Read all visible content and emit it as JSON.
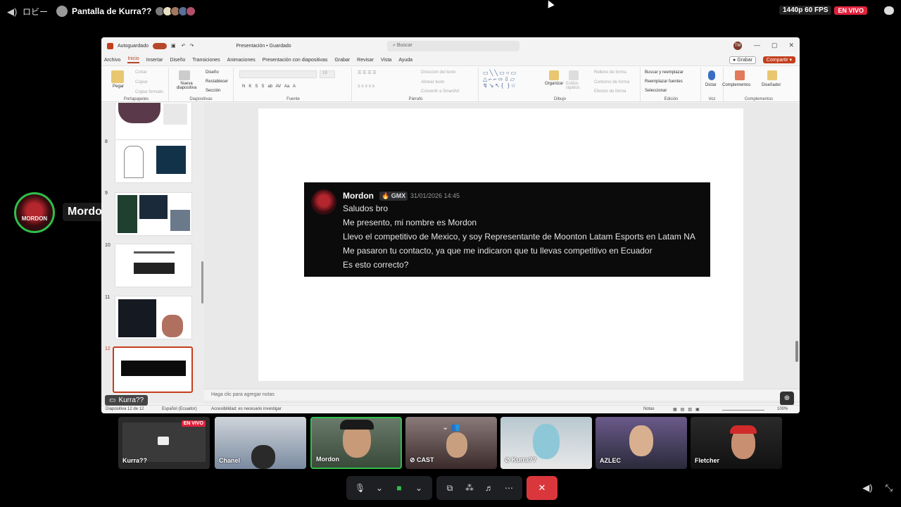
{
  "topbar": {
    "lobby": "ロビー",
    "title": "Pantalla de Kurra??",
    "quality": "1440p 60 FPS",
    "live": "EN VIVO",
    "viewer_colors": [
      "#7a7a7a",
      "#e8e0c0",
      "#a37860",
      "#5a6e9a",
      "#b0506a"
    ]
  },
  "ppt": {
    "autosave": "Autoguardado",
    "doc_title": "Presentación • Guardado",
    "search_placeholder": "Buscar",
    "user_initials": "TM",
    "tabs": [
      "Archivo",
      "Inicio",
      "Insertar",
      "Diseño",
      "Transiciones",
      "Animaciones",
      "Presentación con diapositivas",
      "Grabar",
      "Revisar",
      "Vista",
      "Ayuda"
    ],
    "active_tab": "Inicio",
    "record_label": "Grabar",
    "share_label": "Compartir",
    "groups": {
      "clipboard": {
        "label": "Portapapeles",
        "paste": "Pegar",
        "cut": "Cortar",
        "copy": "Copiar",
        "format": "Copiar formato"
      },
      "slides": {
        "label": "Diapositivas",
        "new": "Nueva diapositiva",
        "layout": "Diseño",
        "reset": "Restablecer",
        "section": "Sección"
      },
      "font": {
        "label": "Fuente",
        "size": "18"
      },
      "paragraph": {
        "label": "Párrafo",
        "direction": "Dirección del texto",
        "align": "Alinear texto",
        "smartart": "Convertir a SmartArt"
      },
      "drawing": {
        "label": "Dibujo",
        "arrange": "Organizar",
        "styles": "Estilos rápidos",
        "fill": "Relleno de forma",
        "outline": "Contorno de forma",
        "effects": "Efectos de forma"
      },
      "editing": {
        "label": "Edición",
        "find": "Buscar y reemplazar",
        "replace": "Reemplazar fuentes",
        "select": "Seleccionar"
      },
      "voice": {
        "label": "Voz",
        "dictate": "Dictar"
      },
      "addins": {
        "label": "Complementos",
        "addins": "Complementos",
        "designer": "Diseñador"
      }
    },
    "slides": [
      "8",
      "9",
      "10",
      "11",
      "12"
    ],
    "notes_placeholder": "Haga clic para agregar notas",
    "status": {
      "slide": "Diapositiva 12 de 12",
      "lang": "Español (Ecuador)",
      "accessibility": "Accesibilidad: es necesario investigar",
      "notes": "Notas",
      "zoom": "100%"
    }
  },
  "discord_msg": {
    "author": "Mordon",
    "tag": "GMX",
    "timestamp": "31/01/2026 14:45",
    "lines": [
      "Saludos bro",
      "Me presento, mi nombre es Mordon",
      "Llevo el competitivo de Mexico, y soy Representante de Moonton Latam Esports en Latam NA",
      "Me pasaron tu contacto, ya que me indicaron que tu llevas competitivo en Ecuador",
      "Es esto correcto?"
    ]
  },
  "presenter_tag": "Kurra??",
  "speaker": {
    "name": "Mordon",
    "avatar_text": "MORDON"
  },
  "tiles": [
    {
      "label": "Kurra??",
      "live": "EN VIVO"
    },
    {
      "label": "Chanel"
    },
    {
      "label": "Mordon"
    },
    {
      "label": "CAST"
    },
    {
      "label": "Kurra??"
    },
    {
      "label": "AZLEC"
    },
    {
      "label": "Fletcher"
    }
  ],
  "controls": {
    "mic": "mic-icon",
    "camera": "camera-icon",
    "screen": "screen-share-icon",
    "activities": "activities-icon",
    "effects": "soundboard-icon",
    "more": "more-icon",
    "leave": "leave-icon"
  }
}
